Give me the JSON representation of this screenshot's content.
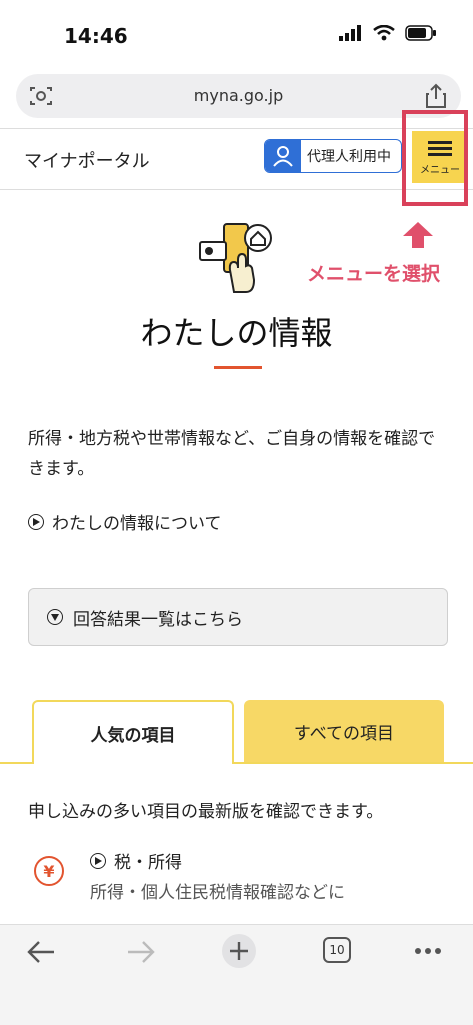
{
  "status": {
    "time": "14:46"
  },
  "browser": {
    "url": "myna.go.jp",
    "tab_count": "10"
  },
  "header": {
    "site_title": "マイナポータル",
    "proxy_label": "代理人利用中",
    "menu_label": "メニュー"
  },
  "annotation": {
    "text": "メニューを選択"
  },
  "page": {
    "heading": "わたしの情報",
    "description": "所得・地方税や世帯情報など、ご自身の情報を確認できます。",
    "about_link": "わたしの情報について",
    "result_link": "回答結果一覧はこちら"
  },
  "tabs": [
    {
      "label": "人気の項目"
    },
    {
      "label": "すべての項目"
    }
  ],
  "popular": {
    "intro": "申し込みの多い項目の最新版を確認できます。",
    "items": [
      {
        "icon": "yen-icon",
        "glyph": "¥",
        "title": "税・所得",
        "subtitle": "所得・個人住民税情報確認などに"
      }
    ]
  },
  "colors": {
    "accent_yellow": "#f7d866",
    "accent_red": "#e2542f",
    "annotation_red": "#d9415a",
    "proxy_blue": "#2f6fd6"
  }
}
